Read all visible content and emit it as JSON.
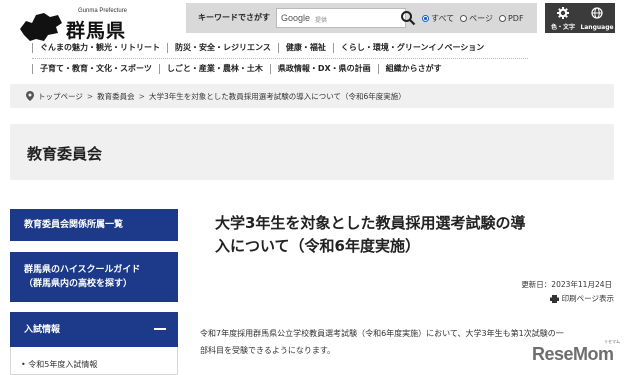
{
  "header": {
    "logo_subtitle": "Gunma Prefecture",
    "logo_title": "群馬県",
    "search": {
      "label": "キーワードでさがす",
      "google_text": "Google",
      "google_sub": "提供",
      "options": [
        "すべて",
        "ページ",
        "PDF"
      ],
      "selected": "すべて"
    },
    "tools": {
      "color_text_label": "色・文字",
      "language_label": "Language"
    }
  },
  "nav": {
    "row1": [
      "ぐんまの魅力・観光・リトリート",
      "防災・安全・レジリエンス",
      "健康・福祉",
      "くらし・環境・グリーンイノベーション"
    ],
    "row2": [
      "子育て・教育・文化・スポーツ",
      "しごと・産業・農林・土木",
      "県政情報・DX・県の計画",
      "組織からさがす"
    ]
  },
  "breadcrumb": [
    "トップページ",
    "教育委員会",
    "大学3年生を対象とした教員採用選考試験の導入について（令和6年度実施）"
  ],
  "section_title": "教育委員会",
  "sidebar": {
    "items": [
      "教育委員会関係所属一覧",
      "群馬県のハイスクールガイド（群馬県内の高校を探す）",
      "入試情報"
    ],
    "item2_line1": "群馬県のハイスクールガイド",
    "item2_line2": "（群馬県内の高校を探す）",
    "list": [
      "令和5年度入試情報"
    ]
  },
  "article": {
    "title_line1": "大学3年生を対象とした教員採用選考試験の導",
    "title_line2": "入について（令和6年度実施）",
    "updated": "更新日：2023年11月24日",
    "print_label": "印刷ページ表示",
    "body_line1": "令和7年度採用群馬県公立学校教員選考試験（令和6年度実施）において、大学3年生も第1次試験の一",
    "body_line2": "部科目を受験できるようになります。"
  },
  "watermark": {
    "text": "ReseMom",
    "sub": "リセマム"
  },
  "colors": {
    "sidebar_blue": "#1d3a8a",
    "tool_dark": "#3b3b3b",
    "panel_gray": "#f0f0f0",
    "radio_blue": "#1a62c4"
  }
}
